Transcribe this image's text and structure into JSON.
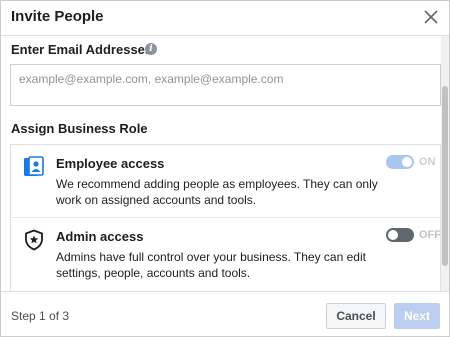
{
  "dialog": {
    "title": "Invite People",
    "close_icon": "close-icon"
  },
  "email_section": {
    "label": "Enter Email Addresses",
    "info_icon": "info-icon",
    "placeholder": "example@example.com, example@example.com",
    "value": ""
  },
  "roles_section": {
    "label": "Assign Business Role",
    "roles": [
      {
        "icon": "employee-badge-icon",
        "title": "Employee access",
        "description": "We recommend adding people as employees. They can only work on assigned accounts and tools.",
        "toggle_state": "on",
        "toggle_label": "ON"
      },
      {
        "icon": "admin-shield-icon",
        "title": "Admin access",
        "description": "Admins have full control over your business. They can edit settings, people, accounts and tools.",
        "toggle_state": "off",
        "toggle_label": "OFF"
      }
    ]
  },
  "footer": {
    "step_text": "Step 1 of 3",
    "cancel_label": "Cancel",
    "next_label": "Next"
  },
  "colors": {
    "accent_blue": "#1877f2",
    "toggle_on": "#a8c7f0",
    "next_disabled": "#bccef0"
  }
}
